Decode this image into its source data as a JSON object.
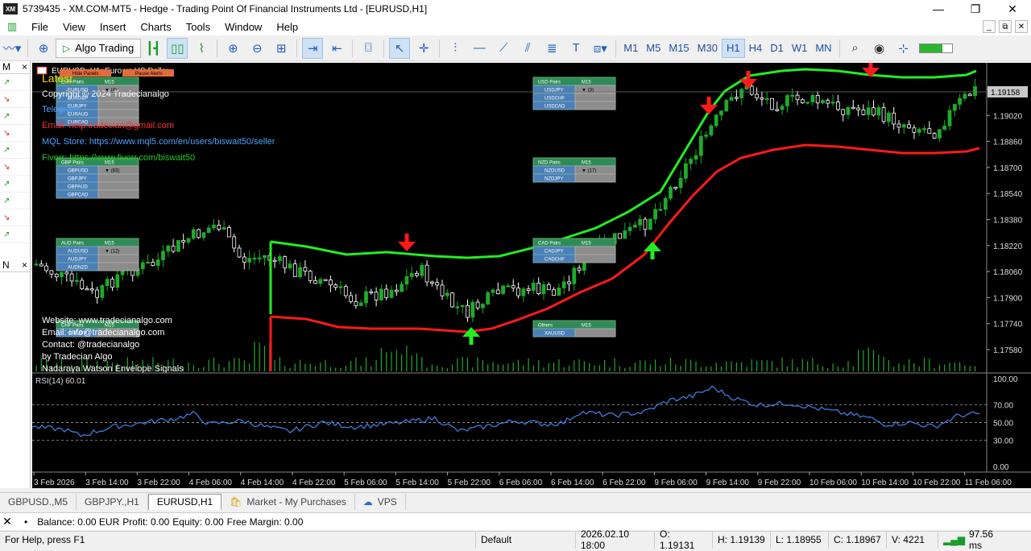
{
  "window": {
    "title": "5739435 - XM.COM-MT5 - Hedge - Trading Point Of Financial Instruments Ltd - [EURUSD,H1]",
    "logo": "XM",
    "minimize": "—",
    "maximize": "❐",
    "close": "✕"
  },
  "menu": {
    "items": [
      "File",
      "View",
      "Insert",
      "Charts",
      "Tools",
      "Window",
      "Help"
    ],
    "child_min": "_",
    "child_restore": "⧉",
    "child_close": "✕"
  },
  "toolbar": {
    "algo_label": "Algo Trading",
    "timeframes": [
      "M1",
      "M5",
      "M15",
      "M30",
      "H1",
      "H4",
      "D1",
      "W1",
      "MN"
    ],
    "selected_timeframe": "H1"
  },
  "left_panel": {
    "market_header": "M",
    "nav_header": "N"
  },
  "chart": {
    "symbol_line": "EURUSD, H1: Euro vs US Dollar",
    "hide_panels": "Hide Panels",
    "pause_alerts": "Pause Alerts",
    "current_price": "1.19158",
    "info_lines": [
      {
        "text": "Latest",
        "color": "#ffd400"
      },
      {
        "text": "Copyright © 2024 Tradecianalgo",
        "color": "#ffffff"
      },
      {
        "text": "Telegram:",
        "color": "#4da3ff"
      },
      {
        "text": "Email: help.tradecian@gmail.com",
        "color": "#ff3030"
      },
      {
        "text": "MQL Store: https://www.mql5.com/en/users/biswait50/seller",
        "color": "#4da3ff"
      },
      {
        "text": "Fiverr: https://www.fiverr.com/biswait50",
        "color": "#28c828"
      }
    ],
    "footer_lines": [
      "Website: www.tradecianalgo.com",
      "Email: info@tradecianalgo.com",
      "Contact: @tradecianalgo",
      "by Tradecian Algo",
      "Nadaraya Watson Envelope Signals"
    ],
    "price_axis": [
      "1.19190",
      "1.19020",
      "1.18860",
      "1.18700",
      "1.18540",
      "1.18380",
      "1.18220",
      "1.18060",
      "1.17900",
      "1.17740",
      "1.17580"
    ],
    "rsi_label": "RSI(14) 60.01",
    "rsi_axis": [
      "100.00",
      "70.00",
      "50.00",
      "30.00",
      "0.00"
    ],
    "time_axis": [
      "3 Feb 2026",
      "3 Feb 14:00",
      "3 Feb 22:00",
      "4 Feb 06:00",
      "4 Feb 14:00",
      "4 Feb 22:00",
      "5 Feb 06:00",
      "5 Feb 14:00",
      "5 Feb 22:00",
      "6 Feb 06:00",
      "6 Feb 14:00",
      "6 Feb 22:00",
      "9 Feb 06:00",
      "9 Feb 14:00",
      "9 Feb 22:00",
      "10 Feb 06:00",
      "10 Feb 14:00",
      "10 Feb 22:00",
      "11 Feb 06:00"
    ],
    "panels": [
      {
        "title": "EUR Pairs",
        "tf": "M15",
        "rows": [
          "EURUSD",
          "EURGBP",
          "EURJPY",
          "EURAUD",
          "EURCAD"
        ],
        "signal": "(4)"
      },
      {
        "title": "GBP Pairs",
        "tf": "M15",
        "rows": [
          "GBPUSD",
          "GBPJPY",
          "GBPAUD",
          "GBPCAD"
        ],
        "signal": "(83)"
      },
      {
        "title": "AUD Pairs",
        "tf": "M15",
        "rows": [
          "AUDUSD",
          "AUDJPY",
          "AUDNZD"
        ],
        "signal": "(12)"
      },
      {
        "title": "CHF Pairs",
        "tf": "M15",
        "rows": [
          "CHFJPY"
        ],
        "signal": ""
      },
      {
        "title": "USD Pairs",
        "tf": "M15",
        "rows": [
          "USDJPY",
          "USDCHF",
          "USDCAD"
        ],
        "signal": "(3)"
      },
      {
        "title": "NZD Pairs",
        "tf": "M15",
        "rows": [
          "NZDUSD",
          "NZDJPY"
        ],
        "signal": "(17)"
      },
      {
        "title": "CAD Pairs",
        "tf": "M15",
        "rows": [
          "CADJPY",
          "CADCHF"
        ],
        "signal": ""
      },
      {
        "title": "Others",
        "tf": "M15",
        "rows": [
          "XAUUSD"
        ],
        "signal": ""
      }
    ]
  },
  "tabs": [
    {
      "label": "GBPUSD.,M5",
      "selected": false
    },
    {
      "label": "GBPJPY.,H1",
      "selected": false
    },
    {
      "label": "EURUSD,H1",
      "selected": true
    },
    {
      "label": "Market - My Purchases",
      "selected": false
    },
    {
      "label": "VPS",
      "selected": false
    }
  ],
  "account": {
    "balance": "Balance: 0.00 EUR",
    "profit": "Profit: 0.00",
    "equity": "Equity: 0.00",
    "free_margin": "Free Margin: 0.00"
  },
  "status": {
    "help": "For Help, press F1",
    "profile": "Default",
    "datetime": "2026.02.10 18:00",
    "open": "O: 1.19131",
    "high": "H: 1.19139",
    "low": "L: 1.18955",
    "close": "C: 1.18967",
    "volume": "V: 4221",
    "ping": "97.56 ms"
  },
  "colors": {
    "bull": "#1faa2a",
    "bear": "#ffffff",
    "upper_band": "#22ee22",
    "lower_band": "#ff1a1a",
    "rsi_line": "#3b7ddd",
    "panel_head": "#2e8b57",
    "panel_row": "#4a7fb8"
  }
}
